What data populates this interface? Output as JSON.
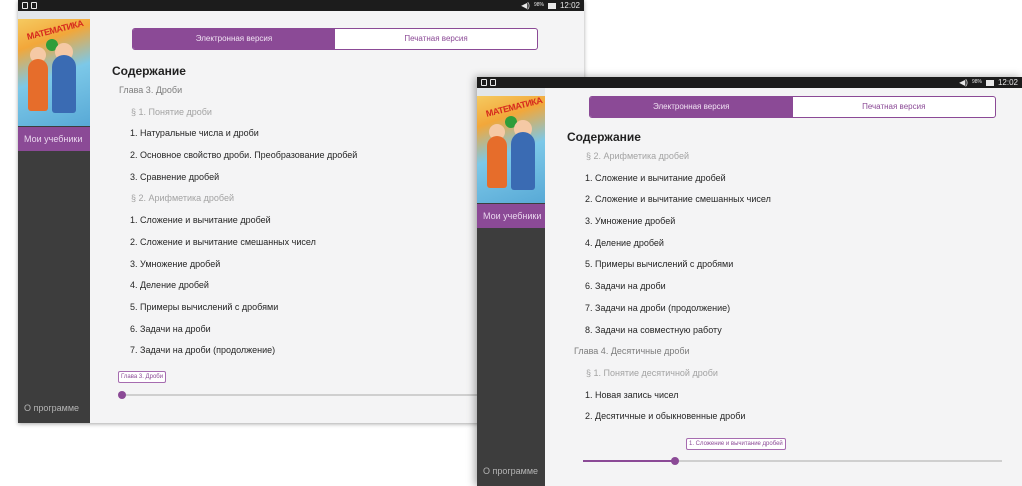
{
  "colors": {
    "accent": "#8b4a96",
    "sidebar": "#3d3d3d",
    "statusbar": "#1c1c1c",
    "content_bg": "#f4f4f5"
  },
  "screens": [
    {
      "statusbar": {
        "battery": "98%",
        "time": "12:02"
      },
      "cover_title": "МАТЕМАТИКА",
      "sidebar": {
        "my_books": "Мои учебники",
        "about": "О программе"
      },
      "tabs": {
        "electronic": "Электронная версия",
        "print": "Печатная версия",
        "active": "electronic"
      },
      "toc_title": "Содержание",
      "rows": [
        {
          "level": "chapter",
          "text": "Глава 3. Дроби"
        },
        {
          "level": "section",
          "text": "§ 1. Понятие дроби"
        },
        {
          "level": "item",
          "text": "1. Натуральные числа и дроби"
        },
        {
          "level": "item",
          "text": "2. Основное свойство дроби. Преобразование дробей"
        },
        {
          "level": "item",
          "text": "3. Сравнение дробей"
        },
        {
          "level": "section",
          "text": "§ 2. Арифметика дробей"
        },
        {
          "level": "item",
          "text": "1. Сложение и вычитание дробей"
        },
        {
          "level": "item",
          "text": "2. Сложение и вычитание смешанных чисел"
        },
        {
          "level": "item",
          "text": "3. Умножение дробей"
        },
        {
          "level": "item",
          "text": "4. Деление дробей"
        },
        {
          "level": "item",
          "text": "5. Примеры вычислений с дробями"
        },
        {
          "level": "item",
          "text": "6. Задачи на дроби"
        },
        {
          "level": "item",
          "text": "7. Задачи на дроби (продолжение)"
        }
      ],
      "scroll": {
        "bubble": "Глава 3. Дроби",
        "progress": 0.0
      }
    },
    {
      "statusbar": {
        "battery": "98%",
        "time": "12:02"
      },
      "cover_title": "МАТЕМАТИКА",
      "sidebar": {
        "my_books": "Мои учебники",
        "about": "О программе"
      },
      "tabs": {
        "electronic": "Электронная версия",
        "print": "Печатная версия",
        "active": "electronic"
      },
      "toc_title": "Содержание",
      "rows": [
        {
          "level": "section",
          "text": "§ 2. Арифметика дробей"
        },
        {
          "level": "item",
          "text": "1. Сложение и вычитание дробей"
        },
        {
          "level": "item",
          "text": "2. Сложение и вычитание смешанных чисел"
        },
        {
          "level": "item",
          "text": "3. Умножение дробей"
        },
        {
          "level": "item",
          "text": "4. Деление дробей"
        },
        {
          "level": "item",
          "text": "5. Примеры вычислений с дробями"
        },
        {
          "level": "item",
          "text": "6. Задачи на дроби"
        },
        {
          "level": "item",
          "text": "7. Задачи на дроби (продолжение)"
        },
        {
          "level": "item",
          "text": "8. Задачи на совместную работу"
        },
        {
          "level": "chapter",
          "text": "Глава 4. Десятичные дроби"
        },
        {
          "level": "section",
          "text": "§ 1. Понятие десятичной дроби"
        },
        {
          "level": "item",
          "text": "1. Новая запись чисел"
        },
        {
          "level": "item",
          "text": "2. Десятичные и обыкновенные дроби"
        }
      ],
      "scroll": {
        "bubble": "1. Сложение и вычитание дробей",
        "progress": 0.22
      }
    }
  ]
}
